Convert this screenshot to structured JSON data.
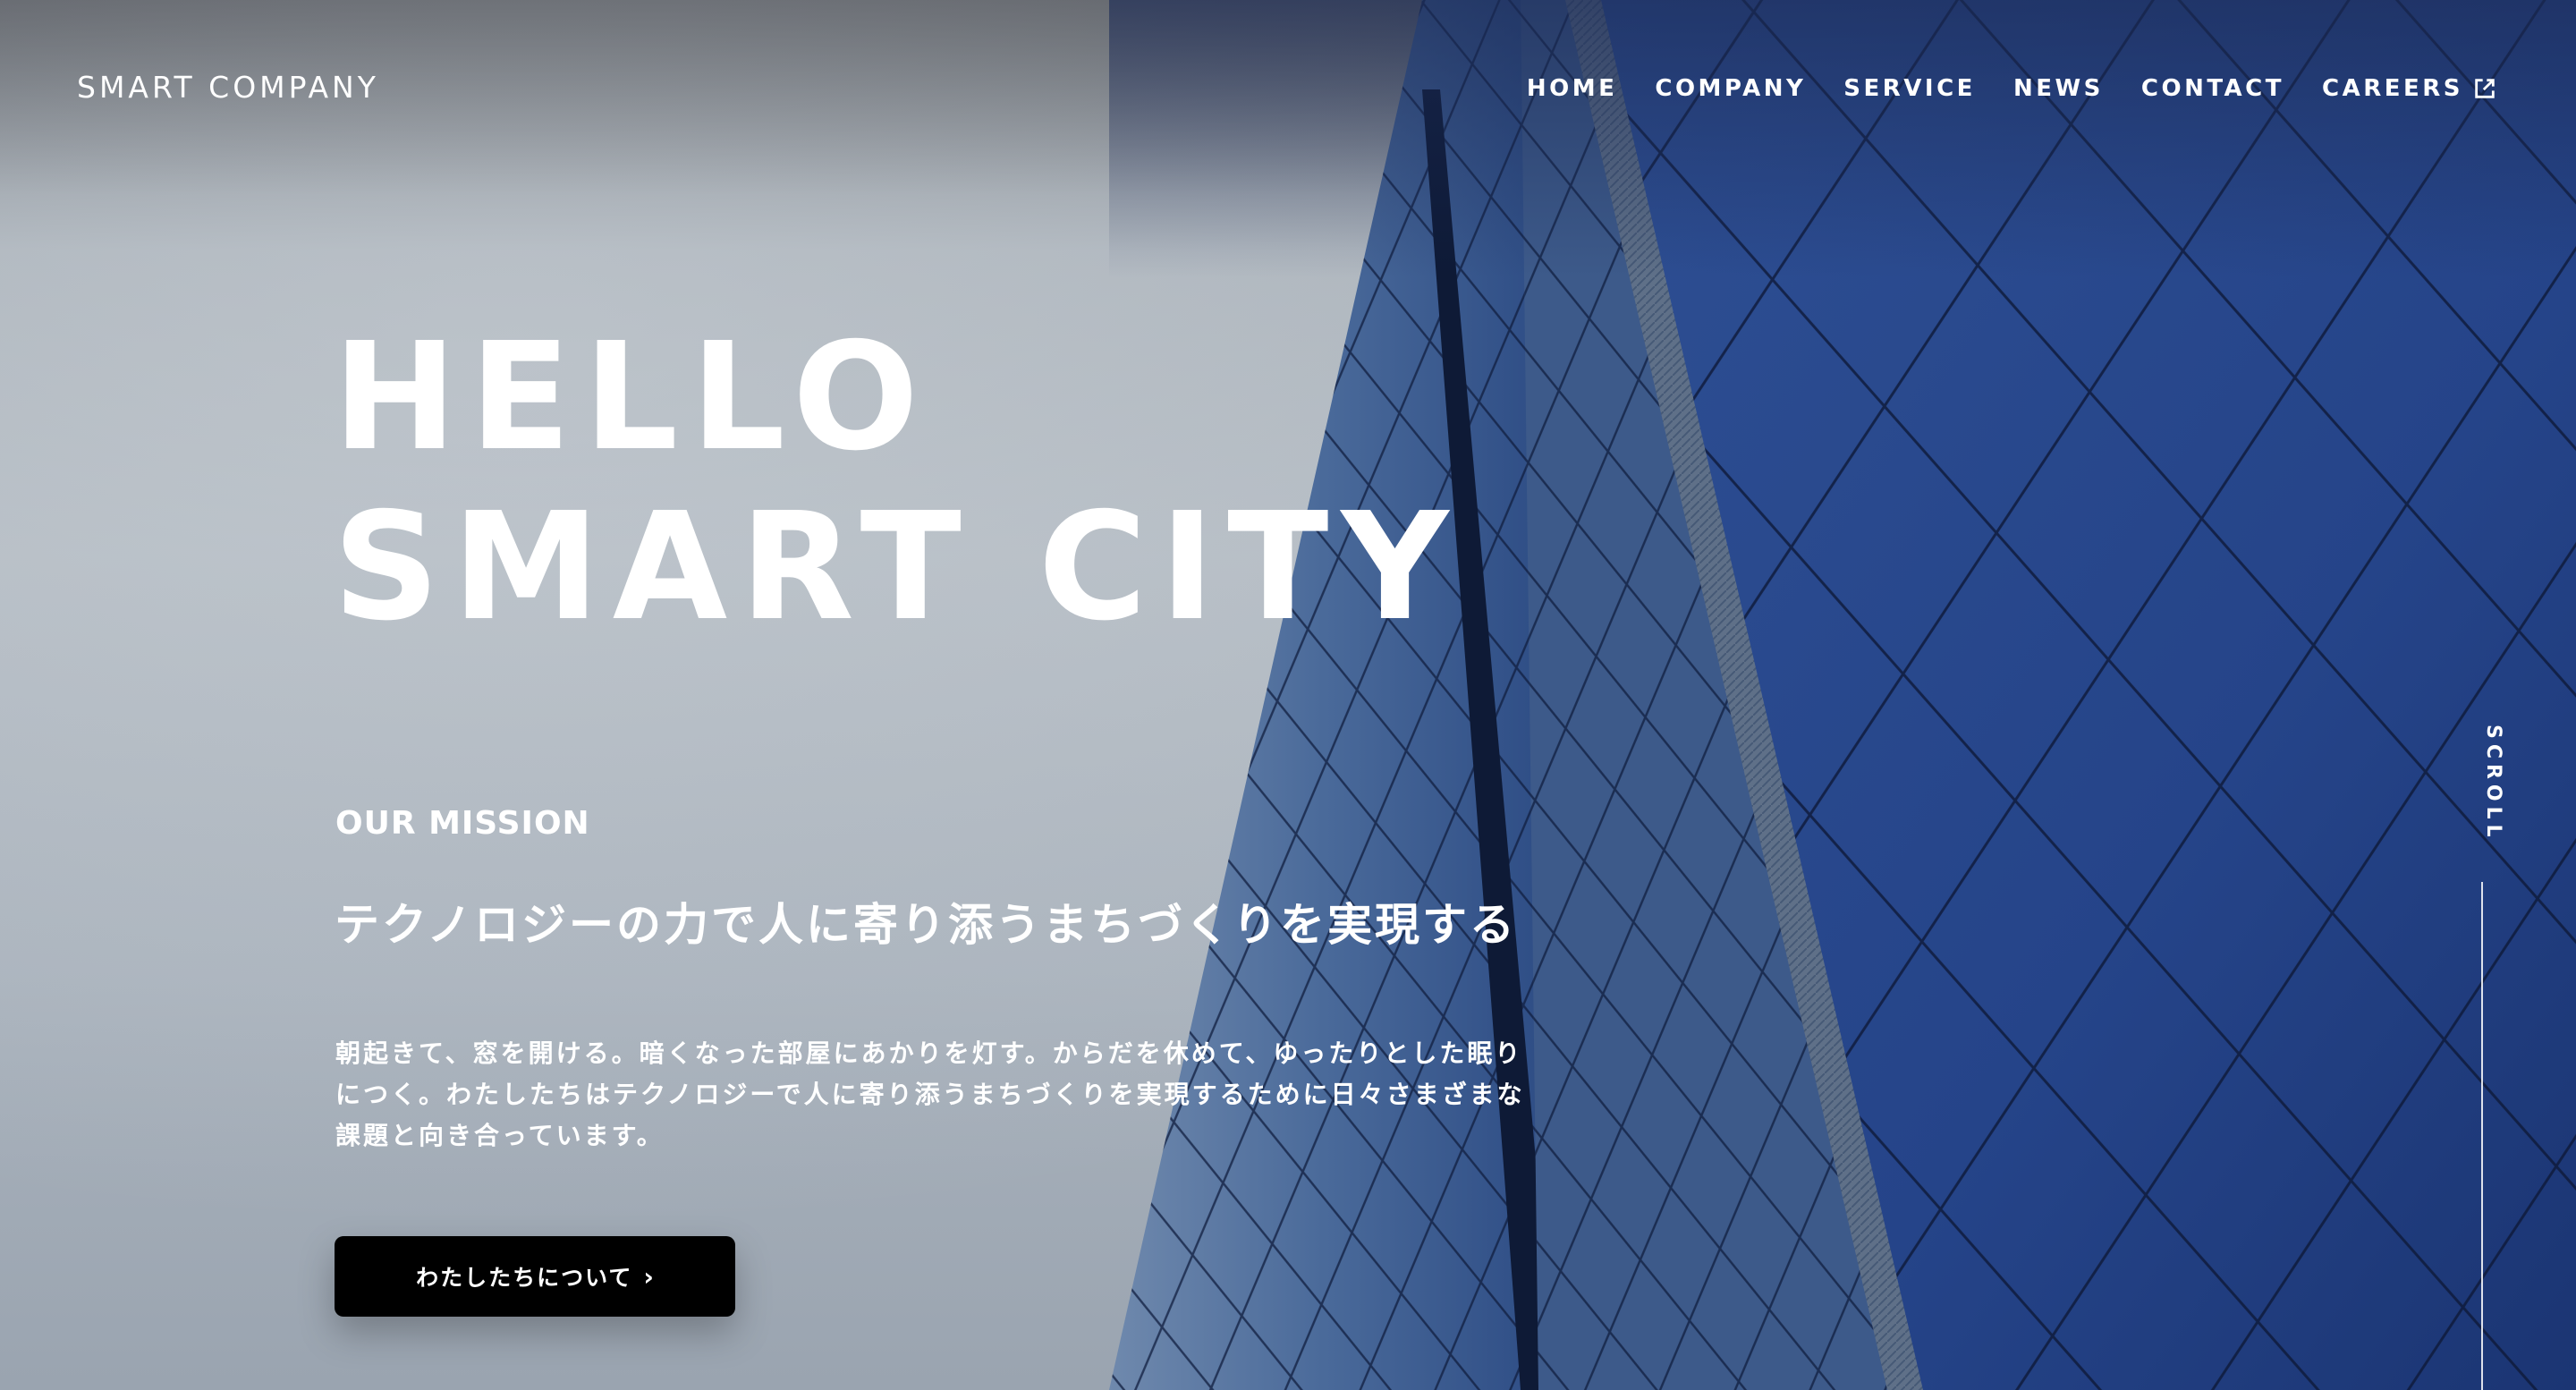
{
  "header": {
    "logo": "SMART COMPANY",
    "nav": [
      {
        "label": "HOME"
      },
      {
        "label": "COMPANY"
      },
      {
        "label": "SERVICE"
      },
      {
        "label": "NEWS"
      },
      {
        "label": "CONTACT"
      },
      {
        "label": "CAREERS",
        "icon": "external-link-icon"
      }
    ]
  },
  "hero": {
    "title_line1": "HELLO",
    "title_line2": "SMART CITY",
    "mission_label": "OUR MISSION",
    "mission_heading": "テクノロジーの力で人に寄り添うまちづくりを実現する",
    "mission_body": "朝起きて、窓を開ける。暗くなった部屋にあかりを灯す。からだを休めて、ゆったりとした眠りにつく。わたしたちはテクノロジーで人に寄り添うまちづくりを実現するために日々さまざまな課題と向き合っています。",
    "cta_label": "わたしたちについて",
    "cta_icon": "chevron-right-icon"
  },
  "scroll": {
    "label": "SCROLL"
  }
}
